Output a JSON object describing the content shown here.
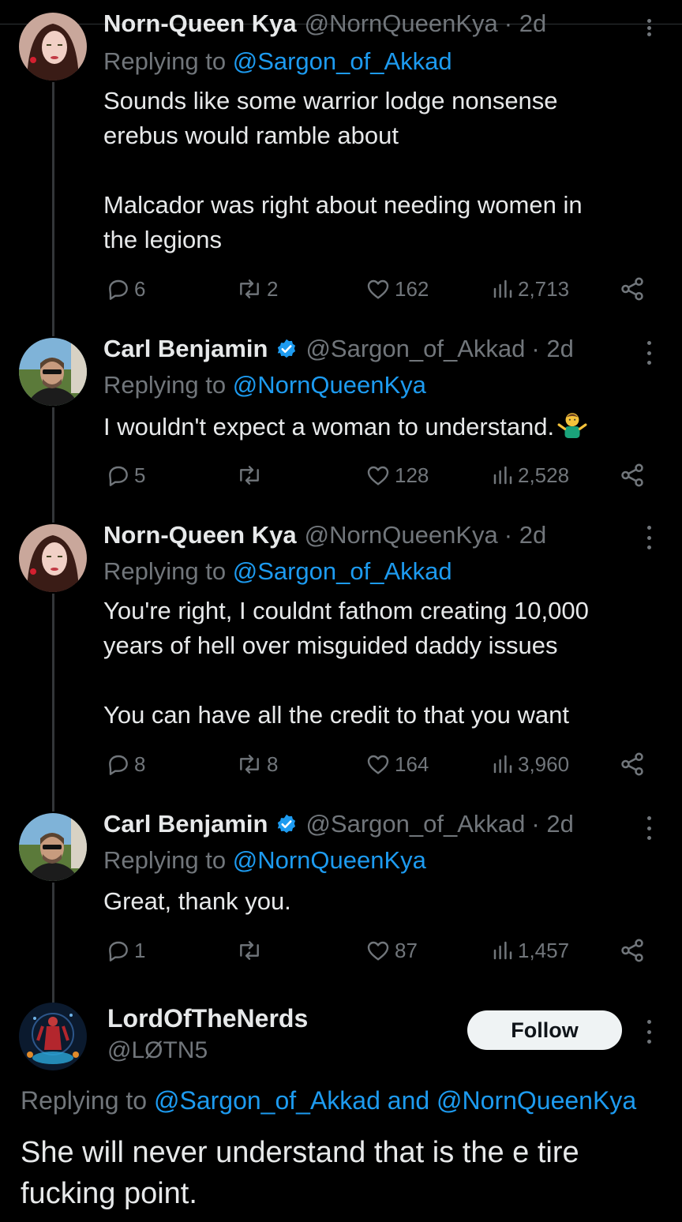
{
  "thread": [
    {
      "name": "Norn-Queen Kya",
      "handle": "@NornQueenKya",
      "time": "· 2d",
      "replying_prefix": "Replying to",
      "replying_to": "@Sargon_of_Akkad",
      "text": "Sounds like some warrior lodge nonsense\nerebus would ramble about\n\nMalcador was right about needing women in\nthe legions",
      "replies": "6",
      "reposts": "2",
      "likes": "162",
      "views": "2,713"
    },
    {
      "name": "Carl Benjamin",
      "handle": "@Sargon_of_Akkad",
      "time": "· 2d",
      "replying_prefix": "Replying to",
      "replying_to": "@NornQueenKya",
      "text": "I wouldn't expect a woman to understand.",
      "emoji": "person-shrugging",
      "replies": "5",
      "reposts": "",
      "likes": "128",
      "views": "2,528"
    },
    {
      "name": "Norn-Queen Kya",
      "handle": "@NornQueenKya",
      "time": "· 2d",
      "replying_prefix": "Replying to",
      "replying_to": "@Sargon_of_Akkad",
      "text": "You're right, I couldnt fathom creating 10,000\nyears of hell over misguided daddy issues\n\nYou can have all the credit to that you want",
      "replies": "8",
      "reposts": "8",
      "likes": "164",
      "views": "3,960"
    },
    {
      "name": "Carl Benjamin",
      "handle": "@Sargon_of_Akkad",
      "time": "· 2d",
      "replying_prefix": "Replying to",
      "replying_to": "@NornQueenKya",
      "text": "Great, thank you.",
      "replies": "1",
      "reposts": "",
      "likes": "87",
      "views": "1,457"
    }
  ],
  "main_tweet": {
    "name": "LordOfTheNerds",
    "handle": "@LØTN5",
    "follow_label": "Follow",
    "replying_prefix": "Replying to",
    "replying_to_1": "@Sargon_of_Akkad",
    "replying_and": "and",
    "replying_to_2": "@NornQueenKya",
    "text": "She will never understand that is the e tire fucking point."
  },
  "colors": {
    "background": "#000000",
    "text": "#e7e9ea",
    "muted": "#71767b",
    "link": "#1d9bf0",
    "verified": "#1d9bf0"
  },
  "icons": [
    "reply-icon",
    "repost-icon",
    "like-icon",
    "views-icon",
    "share-icon",
    "more-icon",
    "verified-badge-icon"
  ]
}
